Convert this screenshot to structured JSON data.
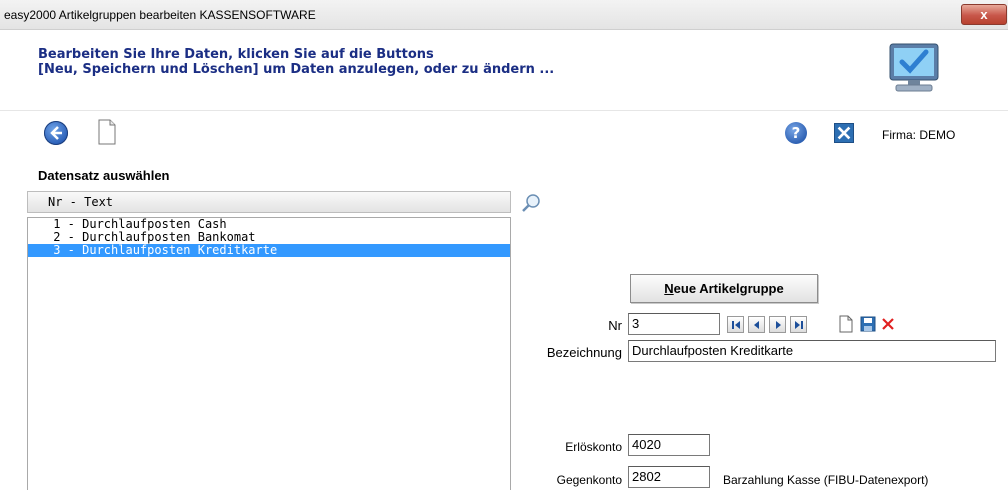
{
  "window": {
    "title": "easy2000 Artikelgruppen bearbeiten KASSENSOFTWARE",
    "close_label": "x"
  },
  "header": {
    "instruction_line1": "Bearbeiten Sie Ihre Daten, klicken Sie auf die Buttons",
    "instruction_line2": "[Neu, Speichern und Löschen] um Daten anzulegen, oder zu ändern ..."
  },
  "toolbar": {
    "help_label": "?",
    "firma_label": "Firma:",
    "firma_value": "DEMO"
  },
  "list": {
    "section_title": "Datensatz auswählen",
    "header": "Nr  - Text",
    "items": [
      {
        "text": " 1 - Durchlaufposten Cash",
        "selected": false
      },
      {
        "text": " 2 - Durchlaufposten Bankomat",
        "selected": false
      },
      {
        "text": " 3 - Durchlaufposten Kreditkarte",
        "selected": true
      }
    ]
  },
  "form": {
    "new_button_underlined": "N",
    "new_button_rest": "eue Artikelgruppe",
    "nr_label": "Nr",
    "nr_value": "3",
    "bezeichnung_label": "Bezeichnung",
    "bezeichnung_value": "Durchlaufposten Kreditkarte",
    "erloeskonto_label": "Erlöskonto",
    "erloeskonto_value": "4020",
    "gegenkonto_label": "Gegenkonto",
    "gegenkonto_value": "2802",
    "gegenkonto_hint": "Barzahlung Kasse (FIBU-Datenexport)"
  },
  "colors": {
    "instruction_text": "#1b2e84",
    "selection": "#3399ff",
    "delete_red": "#e02020",
    "save_blue": "#2d6fb3"
  },
  "icons": {
    "back": "back-arrow-icon",
    "new_document": "document-icon",
    "help": "help-icon",
    "exit": "exit-icon",
    "search": "search-icon",
    "first": "first-record-icon",
    "prev": "previous-record-icon",
    "next": "next-record-icon",
    "last": "last-record-icon",
    "new_record": "new-record-icon",
    "save": "save-icon",
    "delete": "delete-icon",
    "monitor": "monitor-check-icon"
  }
}
